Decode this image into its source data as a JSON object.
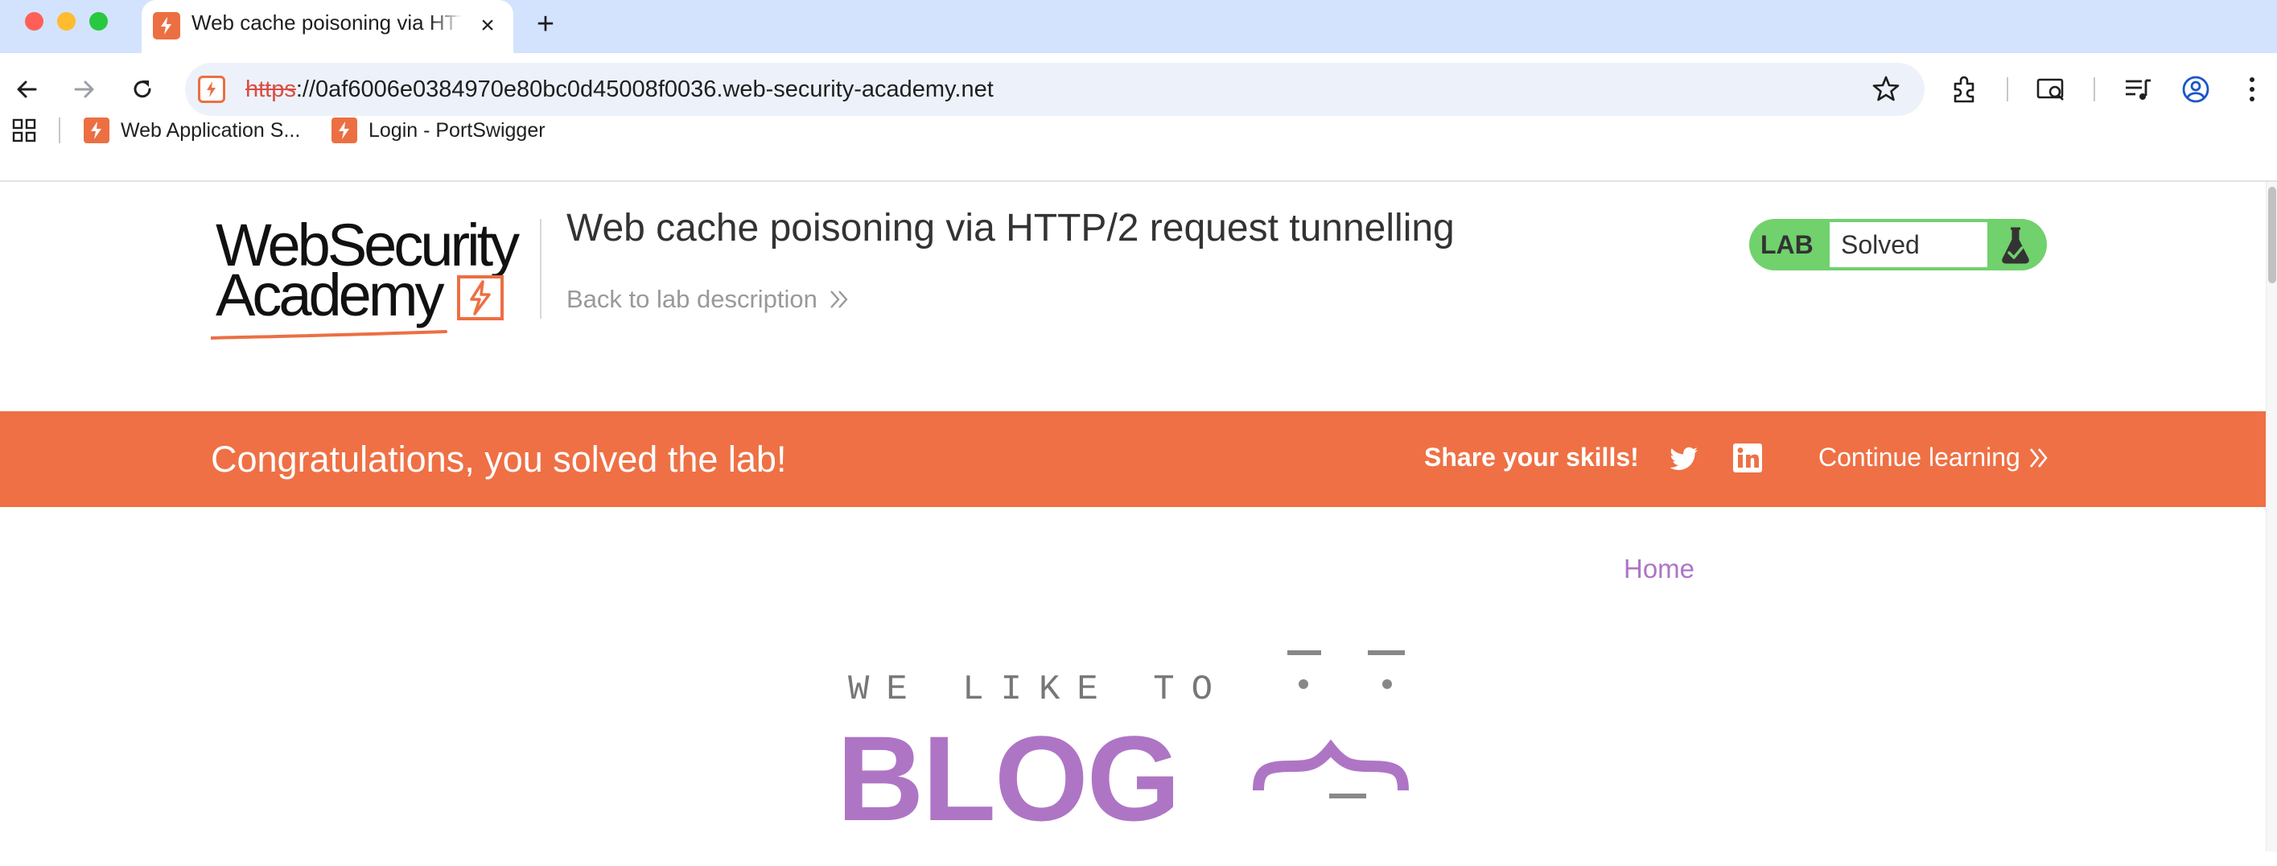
{
  "browser": {
    "tab": {
      "title": "Web cache poisoning via HTTP/2 request tunnelling"
    },
    "address_bar": {
      "scheme": "https",
      "rest": "://0af6006e0384970e80bc0d45008f0036.web-security-academy.net"
    },
    "bookmarks": [
      {
        "label": "Web Application S..."
      },
      {
        "label": "Login - PortSwigger"
      }
    ]
  },
  "header": {
    "logo": {
      "line1": "WebSecurity",
      "line2": "Academy"
    },
    "lab_title": "Web cache poisoning via HTTP/2 request tunnelling",
    "back_link": "Back to lab description",
    "lab_status": {
      "label": "LAB",
      "value": "Solved"
    }
  },
  "banner": {
    "message": "Congratulations, you solved the lab!",
    "share": "Share your skills!",
    "continue": "Continue learning"
  },
  "blog": {
    "nav_home": "Home",
    "tagline": "WE LIKE TO",
    "wordmark": "BLOG"
  },
  "colors": {
    "accent_orange": "#ef7045",
    "lab_solved_green": "#70d16d",
    "blog_purple": "#ae75c5",
    "tabstrip": "#d3e3fd"
  }
}
